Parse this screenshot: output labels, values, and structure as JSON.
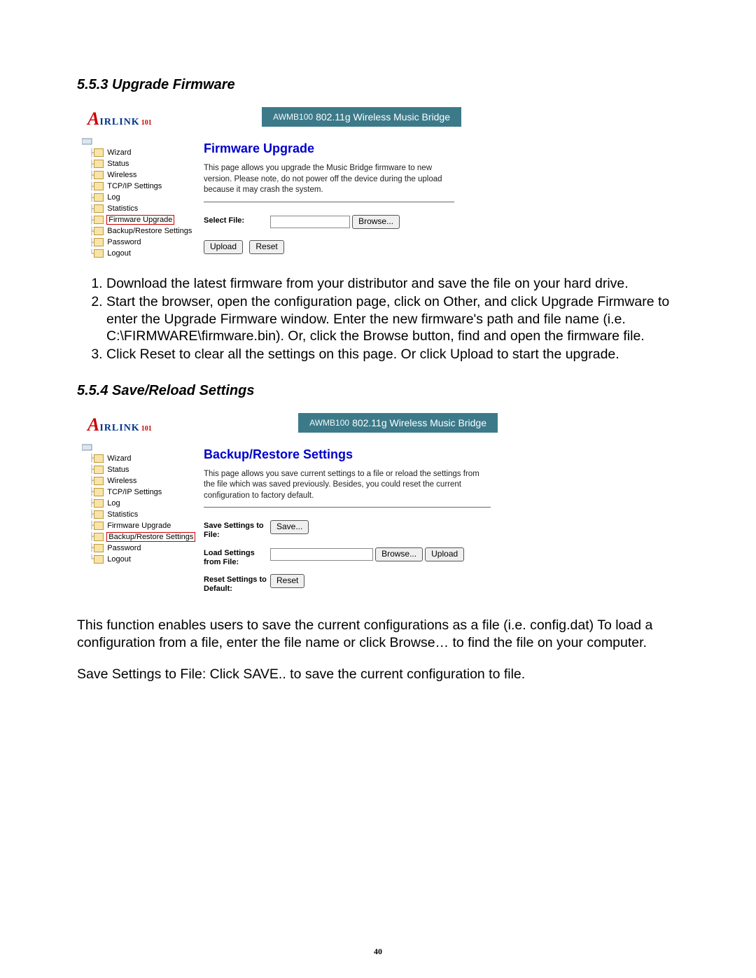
{
  "page_number": "40",
  "section1": {
    "heading": "5.5.3 Upgrade Firmware",
    "logo": {
      "a": "A",
      "rest": "IRLINK",
      "sub": "101"
    },
    "banner": {
      "model": "AWMB100",
      "text": "802.11g Wireless Music Bridge"
    },
    "nav": [
      {
        "label": "Wizard",
        "hl": false
      },
      {
        "label": "Status",
        "hl": false
      },
      {
        "label": "Wireless",
        "hl": false
      },
      {
        "label": "TCP/IP Settings",
        "hl": false
      },
      {
        "label": "Log",
        "hl": false
      },
      {
        "label": "Statistics",
        "hl": false
      },
      {
        "label": "Firmware Upgrade",
        "hl": true
      },
      {
        "label": "Backup/Restore Settings",
        "hl": false
      },
      {
        "label": "Password",
        "hl": false
      },
      {
        "label": "Logout",
        "hl": false
      }
    ],
    "title": "Firmware Upgrade",
    "desc": "This page allows you upgrade the Music Bridge firmware to new version. Please note, do not power off the device during the upload because it may crash the system.",
    "form": {
      "select_file_label": "Select File:",
      "browse": "Browse...",
      "upload": "Upload",
      "reset": "Reset"
    },
    "instructions": [
      "Download the latest firmware from your distributor and save the file on your hard drive.",
      "Start the browser, open the configuration page, click on Other, and click Upgrade Firmware to enter the Upgrade Firmware window. Enter the new firmware's path and file name (i.e. C:\\FIRMWARE\\firmware.bin). Or, click the Browse button, find and open the firmware file.",
      "Click Reset to clear all the settings on this page. Or click Upload to start the upgrade."
    ]
  },
  "section2": {
    "heading": "5.5.4 Save/Reload Settings",
    "logo": {
      "a": "A",
      "rest": "IRLINK",
      "sub": "101"
    },
    "banner": {
      "model": "AWMB100",
      "text": "802.11g Wireless Music Bridge"
    },
    "nav": [
      {
        "label": "Wizard",
        "hl": false
      },
      {
        "label": "Status",
        "hl": false
      },
      {
        "label": "Wireless",
        "hl": false
      },
      {
        "label": "TCP/IP Settings",
        "hl": false
      },
      {
        "label": "Log",
        "hl": false
      },
      {
        "label": "Statistics",
        "hl": false
      },
      {
        "label": "Firmware Upgrade",
        "hl": false
      },
      {
        "label": "Backup/Restore Settings",
        "hl": true
      },
      {
        "label": "Password",
        "hl": false
      },
      {
        "label": "Logout",
        "hl": false
      }
    ],
    "title": "Backup/Restore Settings",
    "desc": "This page allows you save current settings to a file or reload the settings from the file which was saved previously. Besides, you could reset the current configuration to factory default.",
    "form": {
      "save_label": "Save Settings to File:",
      "save_btn": "Save...",
      "load_label": "Load Settings from File:",
      "browse": "Browse...",
      "upload": "Upload",
      "reset_label": "Reset Settings to Default:",
      "reset_btn": "Reset"
    },
    "para1": "This function enables users to save the current configurations as a file (i.e. config.dat) To load a configuration from a file, enter the file name or click Browse… to find the file on your computer.",
    "para2": "Save Settings to File: Click SAVE..  to save the current configuration to file."
  }
}
